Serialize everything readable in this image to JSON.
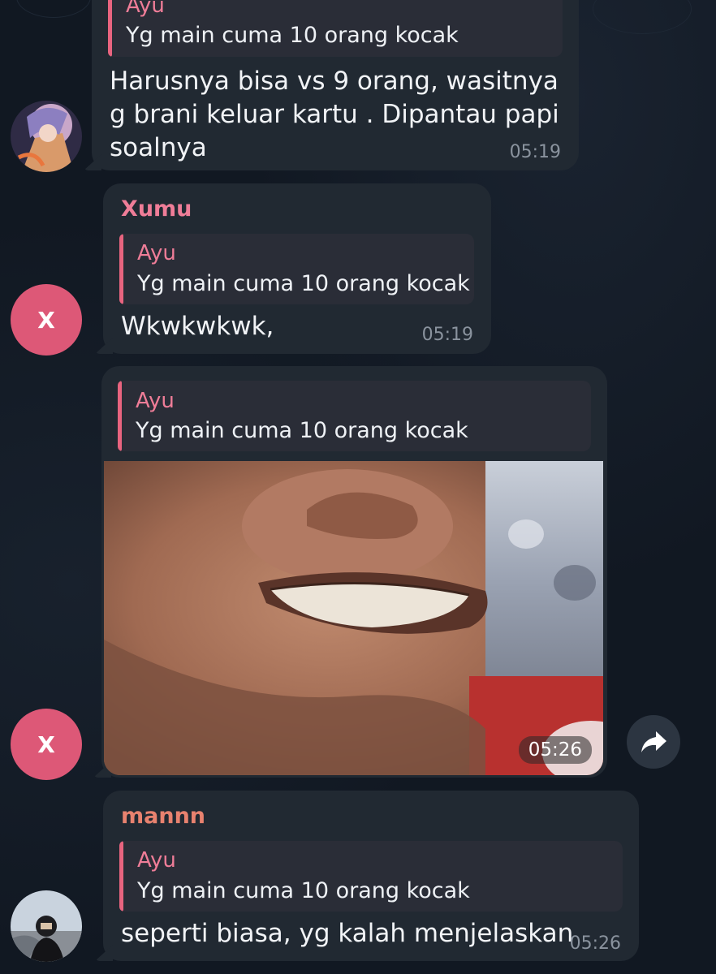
{
  "messages": [
    {
      "reply": {
        "name": "Ayu",
        "text": "Yg main cuma 10 orang kocak"
      },
      "text": "Harusnya bisa vs 9 orang, wasitnya\ng brani keluar kartu . Dipantau papi\nsoalnya",
      "time": "05:19"
    },
    {
      "sender": "Xumu",
      "sender_color": "#ef7d98",
      "avatar_letter": "X",
      "reply": {
        "name": "Ayu",
        "text": "Yg main cuma 10 orang kocak"
      },
      "text": "Wkwkwkwk,",
      "time": "05:19"
    },
    {
      "avatar_letter": "X",
      "reply": {
        "name": "Ayu",
        "text": "Yg main cuma 10 orang kocak"
      },
      "media": "photo",
      "time": "05:26"
    },
    {
      "sender": "mannn",
      "sender_color": "#e8826f",
      "reply": {
        "name": "Ayu",
        "text": "Yg main cuma 10 orang kocak"
      },
      "text": "seperti biasa, yg kalah menjelaskan",
      "time": "05:26"
    }
  ],
  "icons": {
    "share": "share-arrow-icon"
  },
  "colors": {
    "background": "#111822",
    "bubble": "#212932",
    "reply_bar": "#e8647f",
    "avatar": "#dd5877"
  }
}
